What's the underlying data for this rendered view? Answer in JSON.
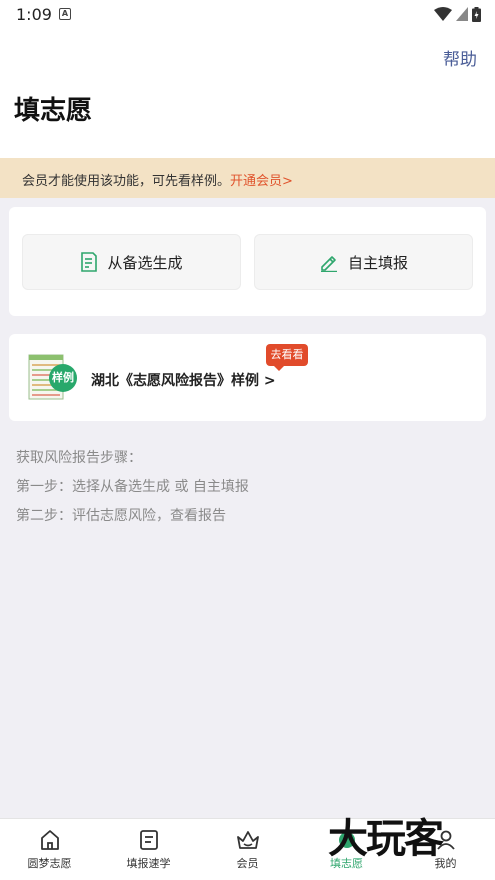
{
  "status": {
    "time": "1:09",
    "a_label": "A"
  },
  "header": {
    "help": "帮助",
    "title": "填志愿"
  },
  "banner": {
    "text": "会员才能使用该功能，可先看样例。",
    "link": "开通会员>"
  },
  "options": [
    {
      "label": "从备选生成",
      "icon": "document-icon"
    },
    {
      "label": "自主填报",
      "icon": "pencil-icon"
    }
  ],
  "sample": {
    "badge": "样例",
    "title": "湖北《志愿风险报告》样例 >",
    "go_tag": "去看看"
  },
  "steps": {
    "heading": "获取风险报告步骤：",
    "step1": "第一步：选择从备选生成 或 自主填报",
    "step2": "第二步：评估志愿风险，查看报告"
  },
  "tabs": [
    {
      "label": "圆梦志愿",
      "icon": "home-icon"
    },
    {
      "label": "填报速学",
      "icon": "book-icon"
    },
    {
      "label": "会员",
      "icon": "crown-icon"
    },
    {
      "label": "填志愿",
      "icon": "fill-icon",
      "active": true
    },
    {
      "label": "我的",
      "icon": "user-icon"
    }
  ],
  "watermark": "大玩客",
  "colors": {
    "accent_green": "#2fa66d",
    "banner_bg": "#f3e2c5",
    "link_red": "#e0542d",
    "help_blue": "#4a5d97"
  }
}
